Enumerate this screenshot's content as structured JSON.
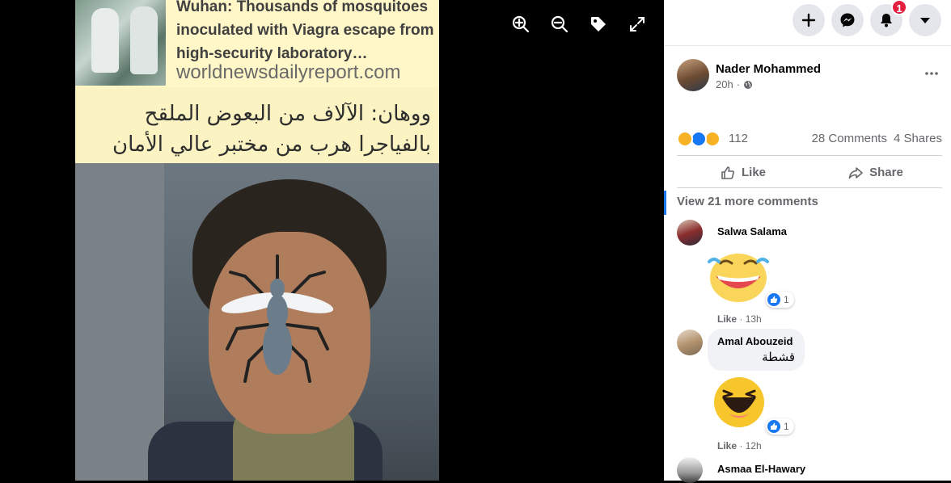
{
  "viewer": {
    "headline_title": "Wuhan: Thousands of mosquitoes inoculated with Viagra escape from high-security laboratory…",
    "headline_site": "worldnewsdailyreport.com",
    "arabic_caption": "ووهان: الآلاف من البعوض الملقح بالفياجرا هرب من مختبر عالي الأمان",
    "controls": [
      "zoom-in-icon",
      "zoom-out-icon",
      "tag-icon",
      "fullscreen-icon"
    ]
  },
  "topbar": {
    "notification_count": "1"
  },
  "post": {
    "author": "Nader Mohammed",
    "time": "20h",
    "reaction_count": "112",
    "comments": "28 Comments",
    "shares": "4 Shares",
    "like_label": "Like",
    "share_label": "Share",
    "view_more": "View 21 more comments"
  },
  "comments": [
    {
      "name": "Salwa Salama",
      "text": "",
      "reactions": "1",
      "like": "Like",
      "time": "13h"
    },
    {
      "name": "Amal Abouzeid",
      "text": "قشطة",
      "reactions": "",
      "like": "",
      "time": ""
    },
    {
      "name": "",
      "text": "",
      "reactions": "1",
      "like": "Like",
      "time": "12h"
    },
    {
      "name": "Asmaa El-Hawary",
      "text": "",
      "reactions": "",
      "like": "",
      "time": ""
    }
  ],
  "colors": {
    "accent": "#1877f2",
    "notification": "#e41e3f",
    "headline_bg": "#fff7c7"
  }
}
